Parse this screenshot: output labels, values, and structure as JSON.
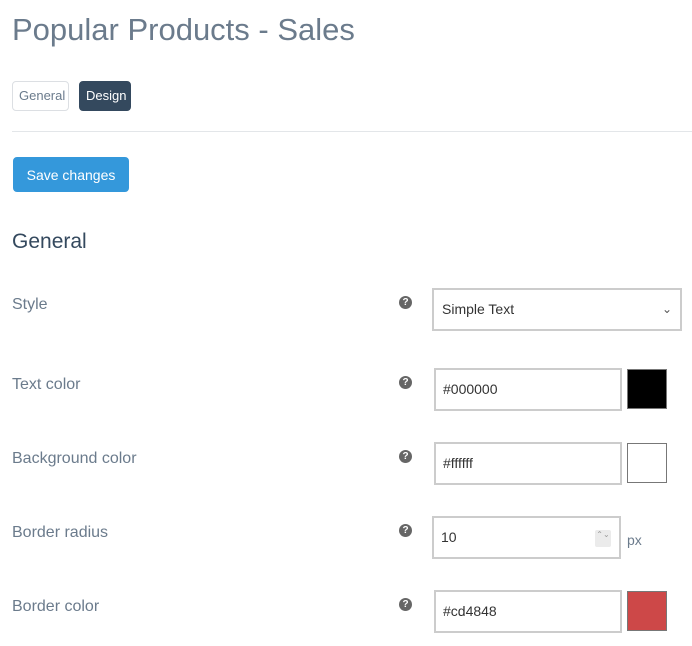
{
  "page": {
    "title": "Popular Products - Sales"
  },
  "tabs": [
    {
      "label": "General",
      "active": false
    },
    {
      "label": "Design",
      "active": true
    }
  ],
  "toolbar": {
    "save_label": "Save changes"
  },
  "section": {
    "title": "General"
  },
  "help_glyph": "?",
  "fields": {
    "style": {
      "label": "Style",
      "value": "Simple Text",
      "chevron": "⌄"
    },
    "text_color": {
      "label": "Text color",
      "value": "#000000",
      "swatch": "#000000"
    },
    "background_color": {
      "label": "Background color",
      "value": "#ffffff",
      "swatch": "#ffffff"
    },
    "border_radius": {
      "label": "Border radius",
      "value": "10",
      "unit": "px",
      "spinner": "⌃⌄"
    },
    "border_color": {
      "label": "Border color",
      "value": "#cd4848",
      "swatch": "#cd4848"
    }
  }
}
